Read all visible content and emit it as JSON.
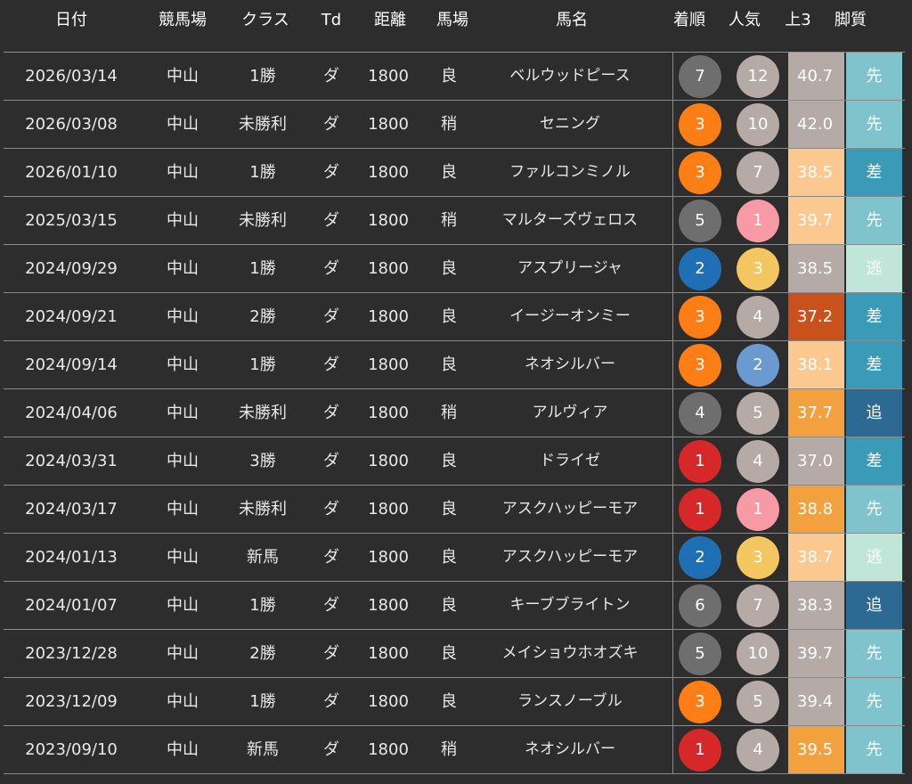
{
  "headers": {
    "date": "日付",
    "track": "競馬場",
    "class": "クラス",
    "td": "Td",
    "distance": "距離",
    "condition": "馬場",
    "horse": "馬名",
    "finish": "着順",
    "popularity": "人気",
    "last3f": "上3",
    "style": "脚質"
  },
  "rows": [
    {
      "date": "2026/03/14",
      "track": "中山",
      "class": "1勝",
      "td": "ダ",
      "distance": "1800",
      "condition": "良",
      "horse": "ベルウッドピース",
      "finish": "7",
      "finish_color": "#6e6e6e",
      "popularity": "12",
      "pop_color": "#b5aaa5",
      "last3f": "40.7",
      "last3f_color": "#b5aaa5",
      "style": "先",
      "style_color": "#7fc3cc"
    },
    {
      "date": "2026/03/08",
      "track": "中山",
      "class": "未勝利",
      "td": "ダ",
      "distance": "1800",
      "condition": "稍",
      "horse": "セニング",
      "finish": "3",
      "finish_color": "#fd7e14",
      "popularity": "10",
      "pop_color": "#b5aaa5",
      "last3f": "42.0",
      "last3f_color": "#b5aaa5",
      "style": "先",
      "style_color": "#7fc3cc"
    },
    {
      "date": "2026/01/10",
      "track": "中山",
      "class": "1勝",
      "td": "ダ",
      "distance": "1800",
      "condition": "良",
      "horse": "ファルコンミノル",
      "finish": "3",
      "finish_color": "#fd7e14",
      "popularity": "7",
      "pop_color": "#b5aaa5",
      "last3f": "38.5",
      "last3f_color": "#fbc98f",
      "style": "差",
      "style_color": "#3a9bb8"
    },
    {
      "date": "2025/03/15",
      "track": "中山",
      "class": "未勝利",
      "td": "ダ",
      "distance": "1800",
      "condition": "稍",
      "horse": "マルターズヴェロス",
      "finish": "5",
      "finish_color": "#6e6e6e",
      "popularity": "1",
      "pop_color": "#f79aa6",
      "last3f": "39.7",
      "last3f_color": "#fbc98f",
      "style": "先",
      "style_color": "#7fc3cc"
    },
    {
      "date": "2024/09/29",
      "track": "中山",
      "class": "1勝",
      "td": "ダ",
      "distance": "1800",
      "condition": "良",
      "horse": "アスプリージャ",
      "finish": "2",
      "finish_color": "#1f6fb4",
      "popularity": "3",
      "pop_color": "#f3c65f",
      "last3f": "38.5",
      "last3f_color": "#b5aaa5",
      "style": "逃",
      "style_color": "#bfe6d9"
    },
    {
      "date": "2024/09/21",
      "track": "中山",
      "class": "2勝",
      "td": "ダ",
      "distance": "1800",
      "condition": "良",
      "horse": "イージーオンミー",
      "finish": "3",
      "finish_color": "#fd7e14",
      "popularity": "4",
      "pop_color": "#b5aaa5",
      "last3f": "37.2",
      "last3f_color": "#c9521c",
      "style": "差",
      "style_color": "#3a9bb8"
    },
    {
      "date": "2024/09/14",
      "track": "中山",
      "class": "1勝",
      "td": "ダ",
      "distance": "1800",
      "condition": "良",
      "horse": "ネオシルバー",
      "finish": "3",
      "finish_color": "#fd7e14",
      "popularity": "2",
      "pop_color": "#6b9ad0",
      "last3f": "38.1",
      "last3f_color": "#fbc98f",
      "style": "差",
      "style_color": "#3a9bb8"
    },
    {
      "date": "2024/04/06",
      "track": "中山",
      "class": "未勝利",
      "td": "ダ",
      "distance": "1800",
      "condition": "稍",
      "horse": "アルヴィア",
      "finish": "4",
      "finish_color": "#6e6e6e",
      "popularity": "5",
      "pop_color": "#b5aaa5",
      "last3f": "37.7",
      "last3f_color": "#f2a13e",
      "style": "追",
      "style_color": "#2c6a93"
    },
    {
      "date": "2024/03/31",
      "track": "中山",
      "class": "3勝",
      "td": "ダ",
      "distance": "1800",
      "condition": "良",
      "horse": "ドライゼ",
      "finish": "1",
      "finish_color": "#d62828",
      "popularity": "4",
      "pop_color": "#b5aaa5",
      "last3f": "37.0",
      "last3f_color": "#b5aaa5",
      "style": "差",
      "style_color": "#3a9bb8"
    },
    {
      "date": "2024/03/17",
      "track": "中山",
      "class": "未勝利",
      "td": "ダ",
      "distance": "1800",
      "condition": "良",
      "horse": "アスクハッピーモア",
      "finish": "1",
      "finish_color": "#d62828",
      "popularity": "1",
      "pop_color": "#f79aa6",
      "last3f": "38.8",
      "last3f_color": "#f2a13e",
      "style": "先",
      "style_color": "#7fc3cc"
    },
    {
      "date": "2024/01/13",
      "track": "中山",
      "class": "新馬",
      "td": "ダ",
      "distance": "1800",
      "condition": "良",
      "horse": "アスクハッピーモア",
      "finish": "2",
      "finish_color": "#1f6fb4",
      "popularity": "3",
      "pop_color": "#f3c65f",
      "last3f": "38.7",
      "last3f_color": "#fbc98f",
      "style": "逃",
      "style_color": "#bfe6d9"
    },
    {
      "date": "2024/01/07",
      "track": "中山",
      "class": "1勝",
      "td": "ダ",
      "distance": "1800",
      "condition": "良",
      "horse": "キーブブライトン",
      "finish": "6",
      "finish_color": "#6e6e6e",
      "popularity": "7",
      "pop_color": "#b5aaa5",
      "last3f": "38.3",
      "last3f_color": "#b5aaa5",
      "style": "追",
      "style_color": "#2c6a93"
    },
    {
      "date": "2023/12/28",
      "track": "中山",
      "class": "2勝",
      "td": "ダ",
      "distance": "1800",
      "condition": "良",
      "horse": "メイショウホオズキ",
      "finish": "5",
      "finish_color": "#6e6e6e",
      "popularity": "10",
      "pop_color": "#b5aaa5",
      "last3f": "39.7",
      "last3f_color": "#b5aaa5",
      "style": "先",
      "style_color": "#7fc3cc"
    },
    {
      "date": "2023/12/09",
      "track": "中山",
      "class": "1勝",
      "td": "ダ",
      "distance": "1800",
      "condition": "良",
      "horse": "ランスノーブル",
      "finish": "3",
      "finish_color": "#fd7e14",
      "popularity": "5",
      "pop_color": "#b5aaa5",
      "last3f": "39.4",
      "last3f_color": "#b5aaa5",
      "style": "先",
      "style_color": "#7fc3cc"
    },
    {
      "date": "2023/09/10",
      "track": "中山",
      "class": "新馬",
      "td": "ダ",
      "distance": "1800",
      "condition": "稍",
      "horse": "ネオシルバー",
      "finish": "1",
      "finish_color": "#d62828",
      "popularity": "4",
      "pop_color": "#b5aaa5",
      "last3f": "39.5",
      "last3f_color": "#f2a13e",
      "style": "先",
      "style_color": "#7fc3cc"
    }
  ]
}
